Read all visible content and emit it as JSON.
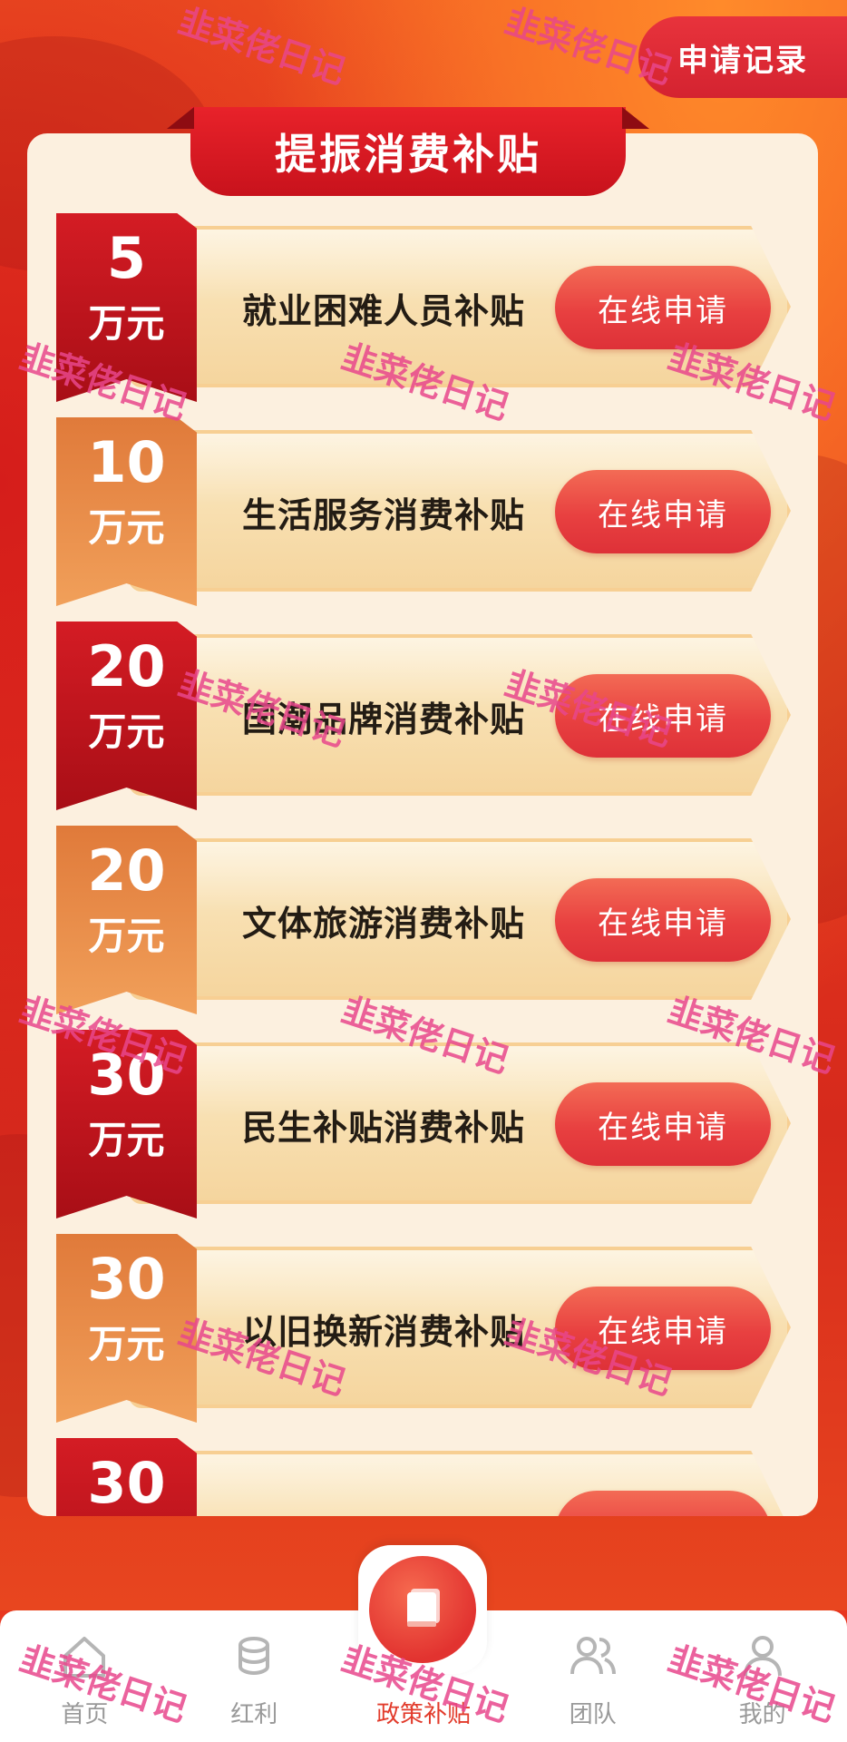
{
  "header": {
    "record_button": "申请记录"
  },
  "panel": {
    "title": "提振消费补贴"
  },
  "subsidies": [
    {
      "amount": "5",
      "unit": "万元",
      "name": "就业困难人员补贴",
      "button": "在线申请",
      "badge_color": "#c3141d"
    },
    {
      "amount": "10",
      "unit": "万元",
      "name": "生活服务消费补贴",
      "button": "在线申请",
      "badge_color": "#e8893f"
    },
    {
      "amount": "20",
      "unit": "万元",
      "name": "国潮品牌消费补贴",
      "button": "在线申请",
      "badge_color": "#c3141d"
    },
    {
      "amount": "20",
      "unit": "万元",
      "name": "文体旅游消费补贴",
      "button": "在线申请",
      "badge_color": "#e8893f"
    },
    {
      "amount": "30",
      "unit": "万元",
      "name": "民生补贴消费补贴",
      "button": "在线申请",
      "badge_color": "#c3141d"
    },
    {
      "amount": "30",
      "unit": "万元",
      "name": "以旧换新消费补贴",
      "button": "在线申请",
      "badge_color": "#e8893f"
    },
    {
      "amount": "30",
      "unit": "",
      "name": "",
      "button": "",
      "badge_color": "#c3141d"
    }
  ],
  "tabbar": {
    "items": [
      {
        "label": "首页",
        "icon": "home-icon"
      },
      {
        "label": "红利",
        "icon": "coins-icon"
      },
      {
        "label": "政策补贴",
        "icon": "book-icon",
        "active": true
      },
      {
        "label": "团队",
        "icon": "team-icon"
      },
      {
        "label": "我的",
        "icon": "user-icon"
      }
    ]
  },
  "watermark": "韭菜佬日记",
  "colors": {
    "accent_red": "#e23b2b",
    "panel_bg": "#fcf0df",
    "watermark": "#e8468c"
  }
}
